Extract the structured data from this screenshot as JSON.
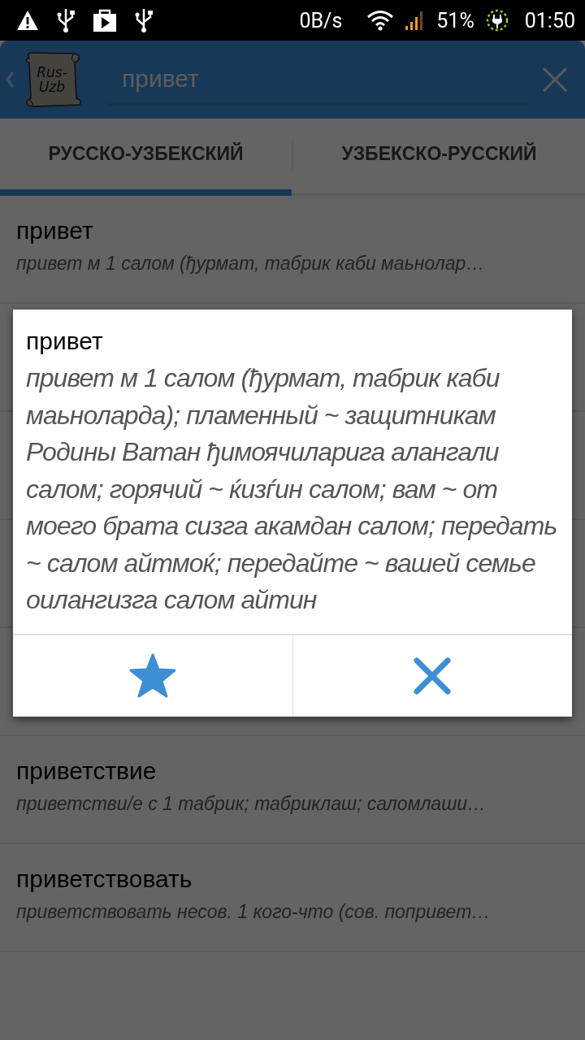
{
  "status_bar": {
    "network_speed": "0B/s",
    "battery": "51%",
    "time": "01:50"
  },
  "toolbar": {
    "logo_text": "Rus-Uzb",
    "search": {
      "value": "привет"
    }
  },
  "tabs": [
    {
      "label": "РУССКО-УЗБЕКСКИЙ",
      "selected": true
    },
    {
      "label": "УЗБЕКСКО-РУССКИЙ",
      "selected": false
    }
  ],
  "entries": [
    {
      "word": "привет",
      "summary": "привет м 1 салом (ђурмат, табрик каби маьнолар…"
    },
    {
      "word": "приветствие",
      "summary": "приветстви/е с 1 табрик; табриклаш; саломлаши…"
    },
    {
      "word": "приветствовать",
      "summary": "приветствовать несов. 1 кого-что (сов. попривет…"
    }
  ],
  "dialog": {
    "word": "привет",
    "definition": "привет м 1 салом (ђурмат, табрик каби маьноларда); пламенный ~ защитникам Родины Ватан ђимоячиларига алангали салом; горячий ~ ќизѓин салом; вам ~ от моего брата сизга акамдан салом; передать ~ салом айтмоќ; передайте ~ вашей семье оилангизга салом айтин"
  }
}
